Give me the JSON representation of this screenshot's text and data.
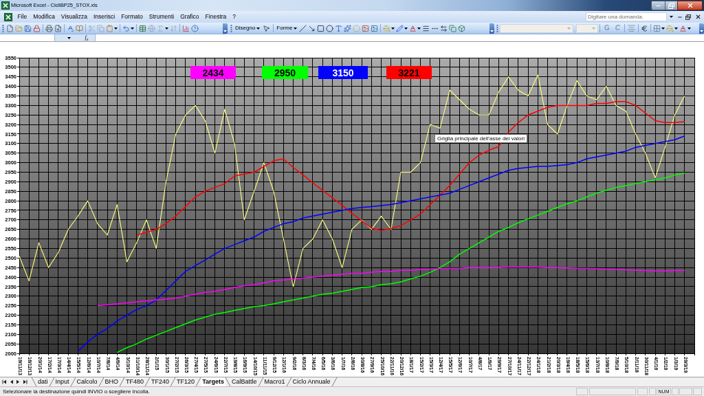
{
  "window": {
    "title": "Microsoft Excel - CicliBP25_STOX.xls"
  },
  "menu": [
    "File",
    "Modifica",
    "Visualizza",
    "Inserisci",
    "Formato",
    "Strumenti",
    "Grafico",
    "Finestra",
    "?"
  ],
  "help_box": {
    "placeholder": "Digitare una domanda."
  },
  "drawing_toolbar": {
    "menus": [
      "Disegno",
      "Forme"
    ]
  },
  "formatting_toolbar": {
    "font_name": {
      "disabled": true
    },
    "font_size": {
      "disabled": true
    },
    "buttons": [
      {
        "label": "G",
        "disabled": true
      },
      {
        "label": "C",
        "disabled": true
      }
    ]
  },
  "formula_bar": {
    "function_button": "f$_{x}$"
  },
  "chart": {
    "chart_data": {
      "type": "line",
      "grid": true,
      "categories": [
        "19/11/13",
        "16/12/13",
        "20/1/14",
        "17/2/14",
        "17/3/14",
        "14/4/14",
        "15/5/14",
        "12/6/14",
        "10/7/14",
        "7/8/14",
        "4/9/14",
        "3/10/14",
        "31/10/14",
        "28/11/14",
        "2/1/15",
        "30/1/15",
        "27/2/15",
        "26/3/15",
        "27/4/15",
        "27/5/15",
        "24/6/15",
        "22/7/15",
        "19/8/15",
        "16/9/15",
        "14/10/15",
        "11/11/15",
        "9/12/15",
        "12/1/16",
        "9/2/16",
        "8/3/16",
        "7/4/16",
        "6/5/16",
        "3/6/16",
        "1/7/16",
        "2/8/16",
        "30/8/16",
        "27/9/16",
        "25/10/16",
        "22/11/16",
        "20/12/16",
        "18/1/17",
        "15/2/17",
        "15/3/17",
        "12/4/17",
        "15/5/17",
        "12/6/17",
        "10/7/17",
        "4/8/17",
        "1/9/17",
        "29/9/17",
        "27/10/17",
        "24/11/17",
        "22/12/17",
        "24/1/18",
        "21/2/18",
        "20/3/18",
        "19/4/18",
        "18/5/18",
        "15/6/18",
        "13/7/18",
        "10/8/18",
        "7/9/18",
        "5/10/18",
        "2/11/18",
        "30/11/18",
        "4/1/19",
        "1/2/19",
        "1/3/19",
        "29/3/19"
      ],
      "ylim": [
        2000,
        3550
      ],
      "yticks": [
        2000,
        2050,
        2100,
        2150,
        2200,
        2250,
        2300,
        2350,
        2400,
        2450,
        2500,
        2550,
        2600,
        2650,
        2700,
        2750,
        2800,
        2850,
        2900,
        2950,
        3000,
        3050,
        3100,
        3150,
        3200,
        3250,
        3300,
        3350,
        3400,
        3450,
        3500,
        3550
      ],
      "series": [
        {
          "color": "#ffff80",
          "values": [
            2510,
            2380,
            2580,
            2450,
            2530,
            2650,
            2720,
            2800,
            2680,
            2620,
            2780,
            2480,
            2580,
            2700,
            2550,
            2900,
            3150,
            3250,
            3300,
            3220,
            3050,
            3280,
            3100,
            2700,
            2850,
            3000,
            2850,
            2600,
            2350,
            2550,
            2600,
            2700,
            2600,
            2450,
            2650,
            2700,
            2650,
            2720,
            2650,
            2950,
            2950,
            3000,
            3200,
            3180,
            3380,
            3330,
            3280,
            3250,
            3250,
            3370,
            3450,
            3380,
            3350,
            3460,
            3200,
            3150,
            3300,
            3430,
            3350,
            3330,
            3400,
            3300,
            3270,
            3150,
            3050,
            2920,
            3080,
            3250,
            3350
          ]
        },
        {
          "color": "#ff0000",
          "values": [
            null,
            null,
            null,
            null,
            null,
            null,
            null,
            null,
            null,
            null,
            null,
            null,
            2620,
            2635,
            2650,
            2680,
            2720,
            2770,
            2820,
            2850,
            2870,
            2890,
            2930,
            2940,
            2950,
            2980,
            3010,
            3020,
            2975,
            2936,
            2894,
            2855,
            2816,
            2776,
            2734,
            2695,
            2656,
            2645,
            2655,
            2670,
            2700,
            2730,
            2780,
            2830,
            2880,
            2940,
            3000,
            3040,
            3065,
            3085,
            3160,
            3210,
            3250,
            3270,
            3290,
            3300,
            3300,
            3300,
            3300,
            3310,
            3310,
            3320,
            3320,
            3300,
            3260,
            3220,
            3210,
            3210,
            3215
          ]
        },
        {
          "color": "#0000ff",
          "values": [
            null,
            null,
            null,
            null,
            null,
            null,
            2010,
            2060,
            2100,
            2130,
            2170,
            2200,
            2230,
            2250,
            2280,
            2330,
            2380,
            2430,
            2460,
            2490,
            2520,
            2550,
            2570,
            2590,
            2610,
            2640,
            2660,
            2680,
            2690,
            2710,
            2720,
            2730,
            2740,
            2750,
            2760,
            2765,
            2770,
            2775,
            2780,
            2790,
            2800,
            2810,
            2820,
            2830,
            2840,
            2860,
            2880,
            2900,
            2920,
            2940,
            2960,
            2970,
            2975,
            2980,
            2980,
            2985,
            2990,
            3000,
            3020,
            3030,
            3040,
            3050,
            3060,
            3080,
            3090,
            3100,
            3110,
            3120,
            3140
          ]
        },
        {
          "color": "#00ff00",
          "values": [
            null,
            null,
            null,
            null,
            null,
            null,
            null,
            null,
            null,
            null,
            2005,
            2030,
            2050,
            2075,
            2095,
            2115,
            2135,
            2155,
            2175,
            2190,
            2205,
            2215,
            2225,
            2235,
            2245,
            2250,
            2260,
            2270,
            2280,
            2290,
            2300,
            2310,
            2315,
            2325,
            2335,
            2345,
            2350,
            2360,
            2365,
            2375,
            2390,
            2405,
            2425,
            2450,
            2480,
            2520,
            2550,
            2580,
            2610,
            2640,
            2660,
            2685,
            2705,
            2725,
            2745,
            2765,
            2785,
            2800,
            2820,
            2840,
            2855,
            2870,
            2880,
            2890,
            2900,
            2910,
            2920,
            2935,
            2945
          ]
        },
        {
          "color": "#ff00ff",
          "values": [
            null,
            null,
            null,
            null,
            null,
            null,
            null,
            null,
            2250,
            2255,
            2260,
            2265,
            2270,
            2275,
            2280,
            2285,
            2290,
            2300,
            2310,
            2320,
            2325,
            2335,
            2345,
            2355,
            2360,
            2370,
            2380,
            2385,
            2390,
            2395,
            2400,
            2405,
            2410,
            2415,
            2420,
            2420,
            2425,
            2430,
            2430,
            2435,
            2435,
            2440,
            2440,
            2445,
            2445,
            2445,
            2450,
            2450,
            2450,
            2450,
            2452,
            2452,
            2452,
            2452,
            2450,
            2450,
            2448,
            2446,
            2445,
            2444,
            2442,
            2440,
            2438,
            2436,
            2434,
            2433,
            2433,
            2434,
            2434
          ]
        }
      ]
    },
    "value_tags": [
      {
        "text": "2434",
        "color": "#ff00ff"
      },
      {
        "text": "2950",
        "color": "#00ff00"
      },
      {
        "text": "3150",
        "color": "#0000ff"
      },
      {
        "text": "3221",
        "color": "#ff0000"
      }
    ],
    "tooltip": "Griglia principale dell'asse dei valori"
  },
  "sheet_tabs": [
    {
      "label": "dati",
      "selected": false
    },
    {
      "label": "Input",
      "selected": false
    },
    {
      "label": "Calcolo",
      "selected": false
    },
    {
      "label": "BHO",
      "selected": false
    },
    {
      "label": "TF480",
      "selected": false
    },
    {
      "label": "TF240",
      "selected": false
    },
    {
      "label": "TF120",
      "selected": false
    },
    {
      "label": "Targets",
      "selected": true
    },
    {
      "label": "CalBattle",
      "selected": false
    },
    {
      "label": "Macro1",
      "selected": false
    },
    {
      "label": "Ciclo Annuale",
      "selected": false
    }
  ],
  "status_bar": {
    "message": "Selezionare la destinazione quindi INVIO o scegliere Incolla.",
    "indicator": "NUM"
  }
}
